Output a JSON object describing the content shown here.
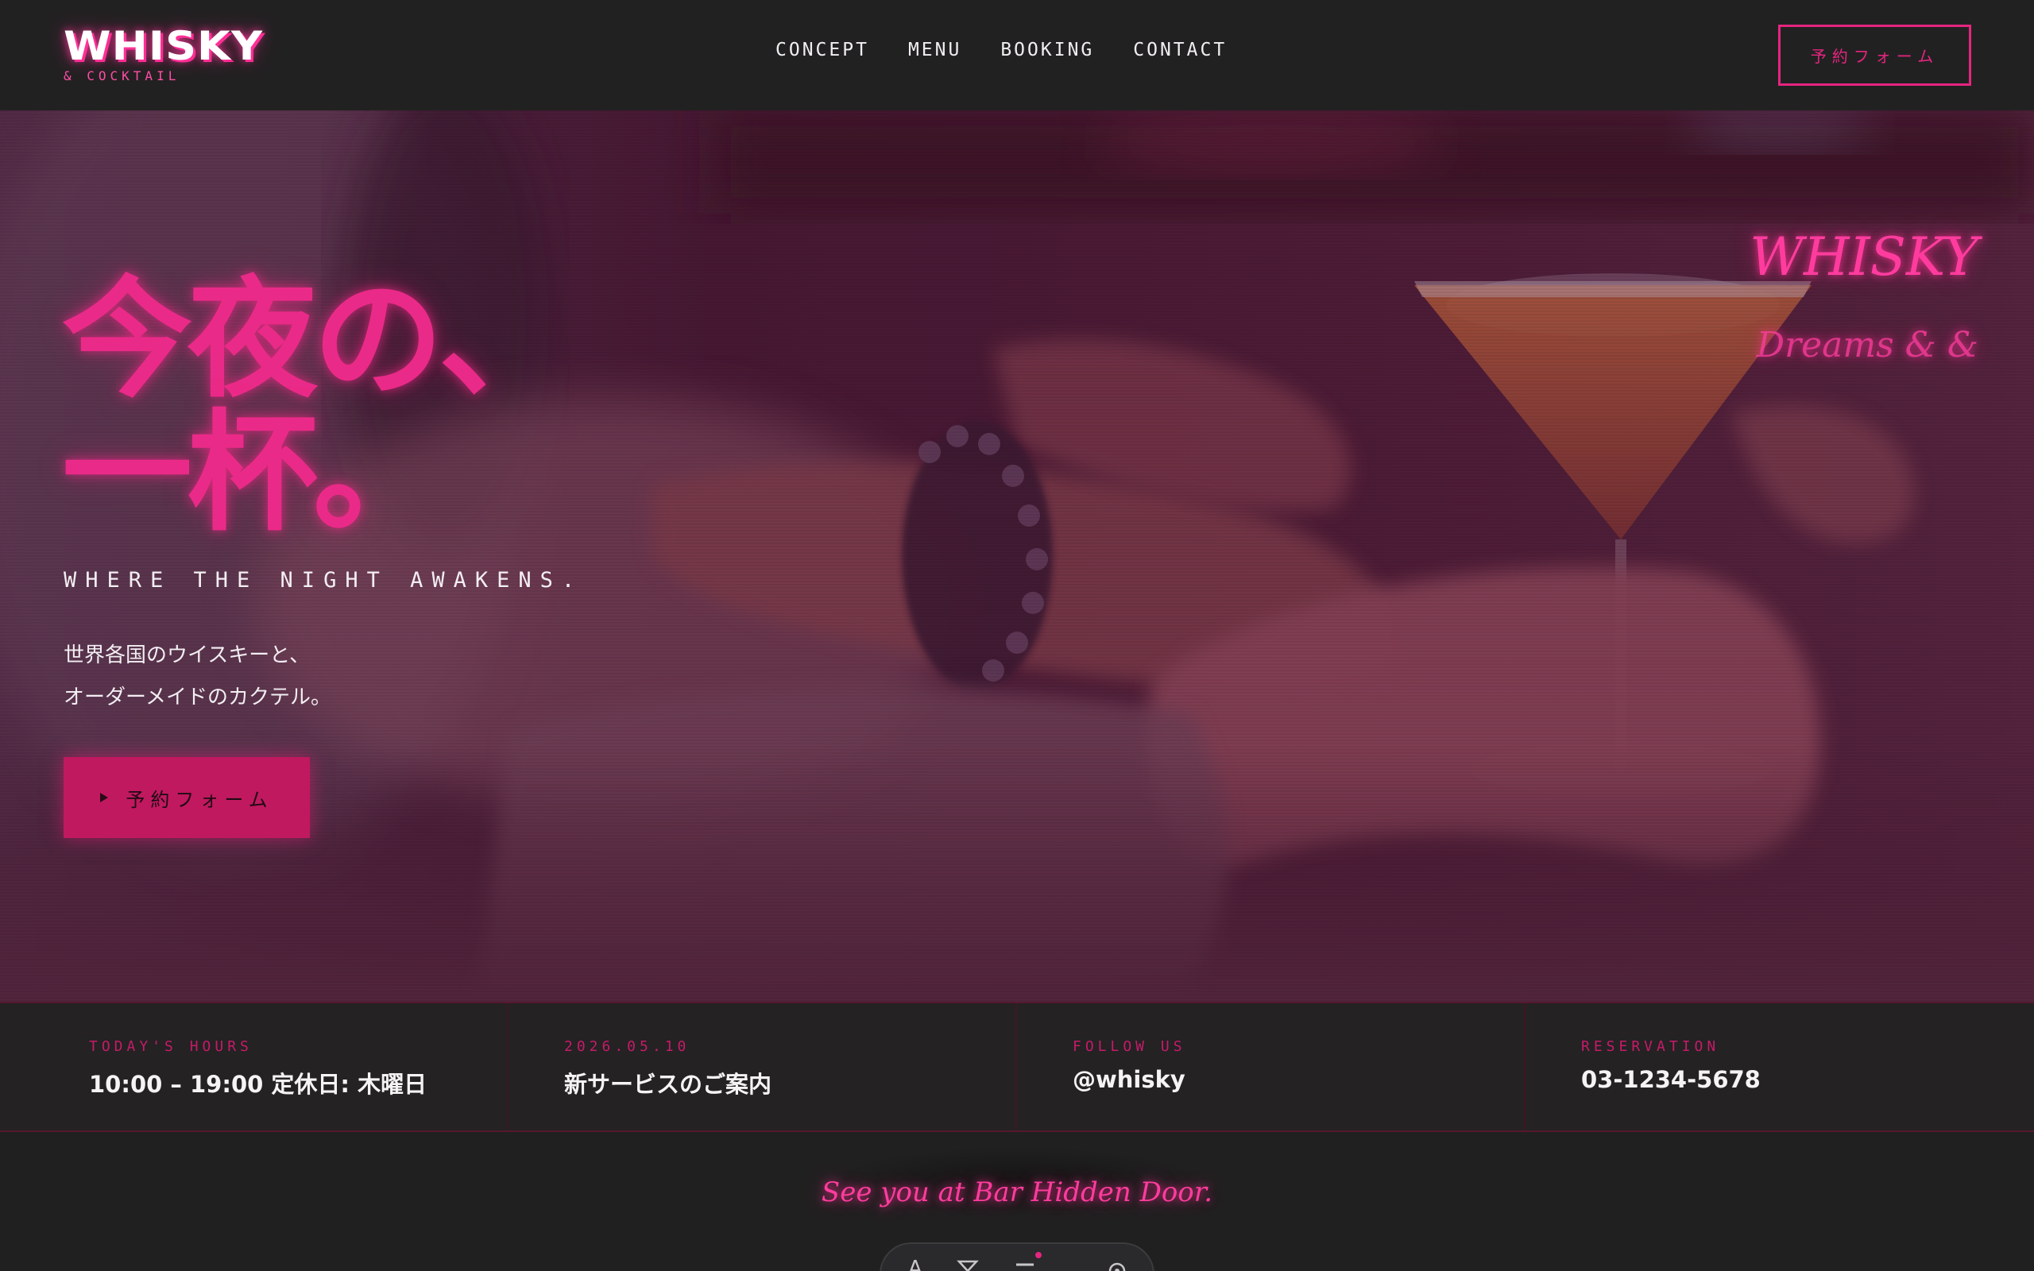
{
  "header": {
    "logo_main": "WHISKY",
    "logo_sub": "& COCKTAIL",
    "nav": [
      "CONCEPT",
      "MENU",
      "BOOKING",
      "CONTACT"
    ],
    "cta_label": "予約フォーム"
  },
  "hero": {
    "title_line1": "今夜の、",
    "title_line2": "一杯。",
    "tagline": "WHERE THE NIGHT AWAKENS.",
    "desc_line1": "世界各国のウイスキーと、",
    "desc_line2": "オーダーメイドのカクテル。",
    "cta_label": "予約フォーム",
    "neon_sign_1": "WHISKY",
    "neon_sign_2": "Dreams & &"
  },
  "info": [
    {
      "label": "TODAY'S HOURS",
      "value": "10:00 – 19:00 定休日: 木曜日"
    },
    {
      "label": "2026.05.10",
      "value": "新サービスのご案内"
    },
    {
      "label": "FOLLOW US",
      "value": "@whisky"
    },
    {
      "label": "RESERVATION",
      "value": "03-1234-5678"
    }
  ],
  "footer": {
    "tagline": "See you at Bar Hidden Door."
  },
  "dock": {
    "icons": [
      "text-icon",
      "cocktail-icon",
      "menu-icon",
      "gear-icon"
    ]
  },
  "colors": {
    "accent": "#e5257f",
    "background": "#212021",
    "neon": "#ff3c9e"
  }
}
